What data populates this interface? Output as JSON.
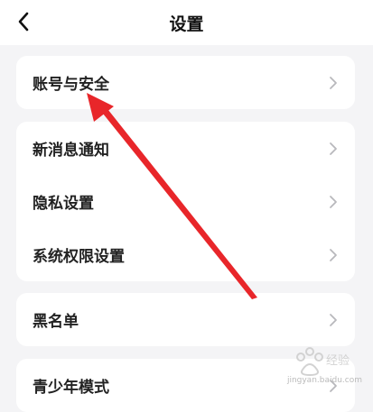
{
  "header": {
    "title": "设置"
  },
  "groups": [
    {
      "items": [
        {
          "label": "账号与安全"
        }
      ]
    },
    {
      "items": [
        {
          "label": "新消息通知"
        },
        {
          "label": "隐私设置"
        },
        {
          "label": "系统权限设置"
        }
      ]
    },
    {
      "items": [
        {
          "label": "黑名单"
        }
      ]
    },
    {
      "items": [
        {
          "label": "青少年模式"
        }
      ]
    }
  ],
  "colors": {
    "background": "#f4f4f6",
    "card": "#ffffff",
    "chevron": "#b8b8bc",
    "annotation_arrow": "#e8262a"
  },
  "watermark": {
    "text": "jingyan.baidu.com"
  }
}
